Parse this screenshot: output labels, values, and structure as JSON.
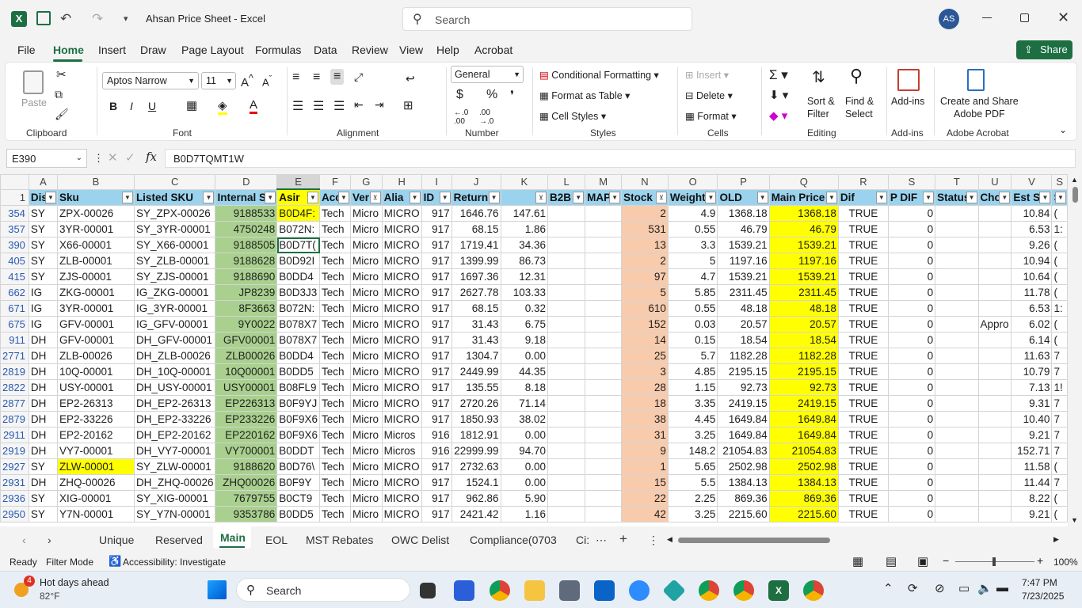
{
  "app": {
    "title": "Ahsan Price Sheet  -  Excel",
    "search_placeholder": "Search",
    "avatar": "AS"
  },
  "menu": [
    "File",
    "Home",
    "Insert",
    "Draw",
    "Page Layout",
    "Formulas",
    "Data",
    "Review",
    "View",
    "Help",
    "Acrobat"
  ],
  "share": "Share",
  "ribbon": {
    "paste": "Paste",
    "font_name": "Aptos Narrow",
    "font_size": "11",
    "number_format": "General",
    "cond_fmt": "Conditional Formatting",
    "fmt_table": "Format as Table",
    "cell_styles": "Cell Styles",
    "insert": "Insert",
    "delete": "Delete",
    "format": "Format",
    "sort_filter": "Sort &\nFilter",
    "find_select": "Find &\nSelect",
    "addins": "Add-ins",
    "create_pdf": "Create and Share\nAdobe PDF",
    "groups": {
      "clipboard": "Clipboard",
      "font": "Font",
      "alignment": "Alignment",
      "number": "Number",
      "styles": "Styles",
      "cells": "Cells",
      "editing": "Editing",
      "addins": "Add-ins",
      "acrobat": "Adobe Acrobat"
    }
  },
  "formula": {
    "namebox": "E390",
    "value": "B0D7TQMT1W"
  },
  "columns": [
    "A",
    "B",
    "C",
    "D",
    "E",
    "F",
    "G",
    "H",
    "I",
    "J",
    "K",
    "L",
    "M",
    "N",
    "O",
    "P",
    "Q",
    "R",
    "S",
    "T",
    "U",
    "V",
    "S"
  ],
  "headers": [
    "Dis",
    "Sku",
    "Listed SKU",
    "Internal S",
    "Asir",
    "Acc",
    "Ver",
    "Alia",
    "ID",
    "Return",
    "",
    "B2B",
    "MAP",
    "Stock",
    "Weight",
    "OLD",
    "Main Price",
    "Dif",
    "P DIF",
    "Status",
    "Cho",
    "Est S",
    "S"
  ],
  "rows": [
    [
      "354",
      "SY",
      "ZPX-00026",
      "SY_ZPX-00026",
      "9188533",
      "B0D4F:",
      "Tech",
      "Micro",
      "MICRO",
      "917",
      "1646.76",
      "147.61",
      "",
      "",
      "2",
      "4.9",
      "1368.18",
      "1368.18",
      "TRUE",
      "0",
      "",
      "",
      "10.84",
      "("
    ],
    [
      "357",
      "SY",
      "3YR-00001",
      "SY_3YR-00001",
      "4750248",
      "B072N:",
      "Tech",
      "Micro",
      "MICRO",
      "917",
      "68.15",
      "1.86",
      "",
      "",
      "531",
      "0.55",
      "46.79",
      "46.79",
      "TRUE",
      "0",
      "",
      "",
      "6.53",
      "1:"
    ],
    [
      "390",
      "SY",
      "X66-00001",
      "SY_X66-00001",
      "9188505",
      "B0D7T(",
      "Tech",
      "Micro",
      "MICRO",
      "917",
      "1719.41",
      "34.36",
      "",
      "",
      "13",
      "3.3",
      "1539.21",
      "1539.21",
      "TRUE",
      "0",
      "",
      "",
      "9.26",
      "("
    ],
    [
      "405",
      "SY",
      "ZLB-00001",
      "SY_ZLB-00001",
      "9188628",
      "B0D92I",
      "Tech",
      "Micro",
      "MICRO",
      "917",
      "1399.99",
      "86.73",
      "",
      "",
      "2",
      "5",
      "1197.16",
      "1197.16",
      "TRUE",
      "0",
      "",
      "",
      "10.94",
      "("
    ],
    [
      "415",
      "SY",
      "ZJS-00001",
      "SY_ZJS-00001",
      "9188690",
      "B0DD4",
      "Tech",
      "Micro",
      "MICRO",
      "917",
      "1697.36",
      "12.31",
      "",
      "",
      "97",
      "4.7",
      "1539.21",
      "1539.21",
      "TRUE",
      "0",
      "",
      "",
      "10.64",
      "("
    ],
    [
      "662",
      "IG",
      "ZKG-00001",
      "IG_ZKG-00001",
      "JP8239",
      "B0D3J3",
      "Tech",
      "Micro",
      "MICRO",
      "917",
      "2627.78",
      "103.33",
      "",
      "",
      "5",
      "5.85",
      "2311.45",
      "2311.45",
      "TRUE",
      "0",
      "",
      "",
      "11.78",
      "("
    ],
    [
      "671",
      "IG",
      "3YR-00001",
      "IG_3YR-00001",
      "8F3663",
      "B072N:",
      "Tech",
      "Micro",
      "MICRO",
      "917",
      "68.15",
      "0.32",
      "",
      "",
      "610",
      "0.55",
      "48.18",
      "48.18",
      "TRUE",
      "0",
      "",
      "",
      "6.53",
      "1:"
    ],
    [
      "675",
      "IG",
      "GFV-00001",
      "IG_GFV-00001",
      "9Y0022",
      "B078X7",
      "Tech",
      "Micro",
      "MICRO",
      "917",
      "31.43",
      "6.75",
      "",
      "",
      "152",
      "0.03",
      "20.57",
      "20.57",
      "TRUE",
      "0",
      "",
      "Appro",
      "6.02",
      "("
    ],
    [
      "911",
      "DH",
      "GFV-00001",
      "DH_GFV-00001",
      "GFV00001",
      "B078X7",
      "Tech",
      "Micro",
      "MICRO",
      "917",
      "31.43",
      "9.18",
      "",
      "",
      "14",
      "0.15",
      "18.54",
      "18.54",
      "TRUE",
      "0",
      "",
      "",
      "6.14",
      "("
    ],
    [
      "2771",
      "DH",
      "ZLB-00026",
      "DH_ZLB-00026",
      "ZLB00026",
      "B0DD4",
      "Tech",
      "Micro",
      "MICRO",
      "917",
      "1304.7",
      "0.00",
      "",
      "",
      "25",
      "5.7",
      "1182.28",
      "1182.28",
      "TRUE",
      "0",
      "",
      "",
      "11.63",
      "7"
    ],
    [
      "2819",
      "DH",
      "10Q-00001",
      "DH_10Q-00001",
      "10Q00001",
      "B0DD5",
      "Tech",
      "Micro",
      "MICRO",
      "917",
      "2449.99",
      "44.35",
      "",
      "",
      "3",
      "4.85",
      "2195.15",
      "2195.15",
      "TRUE",
      "0",
      "",
      "",
      "10.79",
      "7"
    ],
    [
      "2822",
      "DH",
      "USY-00001",
      "DH_USY-00001",
      "USY00001",
      "B08FL9",
      "Tech",
      "Micro",
      "MICRO",
      "917",
      "135.55",
      "8.18",
      "",
      "",
      "28",
      "1.15",
      "92.73",
      "92.73",
      "TRUE",
      "0",
      "",
      "",
      "7.13",
      "1!"
    ],
    [
      "2877",
      "DH",
      "EP2-26313",
      "DH_EP2-26313",
      "EP226313",
      "B0F9YJ",
      "Tech",
      "Micro",
      "MICRO",
      "917",
      "2720.26",
      "71.14",
      "",
      "",
      "18",
      "3.35",
      "2419.15",
      "2419.15",
      "TRUE",
      "0",
      "",
      "",
      "9.31",
      "7"
    ],
    [
      "2879",
      "DH",
      "EP2-33226",
      "DH_EP2-33226",
      "EP233226",
      "B0F9X6",
      "Tech",
      "Micro",
      "MICRO",
      "917",
      "1850.93",
      "38.02",
      "",
      "",
      "38",
      "4.45",
      "1649.84",
      "1649.84",
      "TRUE",
      "0",
      "",
      "",
      "10.40",
      "7"
    ],
    [
      "2911",
      "DH",
      "EP2-20162",
      "DH_EP2-20162",
      "EP220162",
      "B0F9X6",
      "Tech",
      "Micro",
      "Micros",
      "916",
      "1812.91",
      "0.00",
      "",
      "",
      "31",
      "3.25",
      "1649.84",
      "1649.84",
      "TRUE",
      "0",
      "",
      "",
      "9.21",
      "7"
    ],
    [
      "2919",
      "DH",
      "VY7-00001",
      "DH_VY7-00001",
      "VY700001",
      "B0DDT",
      "Tech",
      "Micro",
      "Micros",
      "916",
      "22999.99",
      "94.70",
      "",
      "",
      "9",
      "148.2",
      "21054.83",
      "21054.83",
      "TRUE",
      "0",
      "",
      "",
      "152.71",
      "7"
    ],
    [
      "2927",
      "SY",
      "ZLW-00001",
      "SY_ZLW-00001",
      "9188620",
      "B0D76\\",
      "Tech",
      "Micro",
      "MICRO",
      "917",
      "2732.63",
      "0.00",
      "",
      "",
      "1",
      "5.65",
      "2502.98",
      "2502.98",
      "TRUE",
      "0",
      "",
      "",
      "11.58",
      "("
    ],
    [
      "2931",
      "DH",
      "ZHQ-00026",
      "DH_ZHQ-00026",
      "ZHQ00026",
      "B0F9Y",
      "Tech",
      "Micro",
      "MICRO",
      "917",
      "1524.1",
      "0.00",
      "",
      "",
      "15",
      "5.5",
      "1384.13",
      "1384.13",
      "TRUE",
      "0",
      "",
      "",
      "11.44",
      "7"
    ],
    [
      "2936",
      "SY",
      "XIG-00001",
      "SY_XIG-00001",
      "7679755",
      "B0CT9",
      "Tech",
      "Micro",
      "MICRO",
      "917",
      "962.86",
      "5.90",
      "",
      "",
      "22",
      "2.25",
      "869.36",
      "869.36",
      "TRUE",
      "0",
      "",
      "",
      "8.22",
      "("
    ],
    [
      "2950",
      "SY",
      "Y7N-00001",
      "SY_Y7N-00001",
      "9353786",
      "B0DD5",
      "Tech",
      "Micro",
      "MICRO",
      "917",
      "2421.42",
      "1.16",
      "",
      "",
      "42",
      "3.25",
      "2215.60",
      "2215.60",
      "TRUE",
      "0",
      "",
      "",
      "9.21",
      "("
    ]
  ],
  "sheets": [
    "Unique",
    "Reserved",
    "Main",
    "EOL",
    "MST Rebates",
    "OWC Delist",
    "Compliance(0703",
    "Ci:"
  ],
  "active_sheet": "Main",
  "status": {
    "ready": "Ready",
    "filter": "Filter Mode",
    "accessibility": "Accessibility: Investigate",
    "zoom": "100%"
  },
  "taskbar": {
    "weather_title": "Hot days ahead",
    "weather_temp": "82°F",
    "badge": "4",
    "search": "Search",
    "time": "7:47 PM",
    "date": "7/23/2025"
  }
}
